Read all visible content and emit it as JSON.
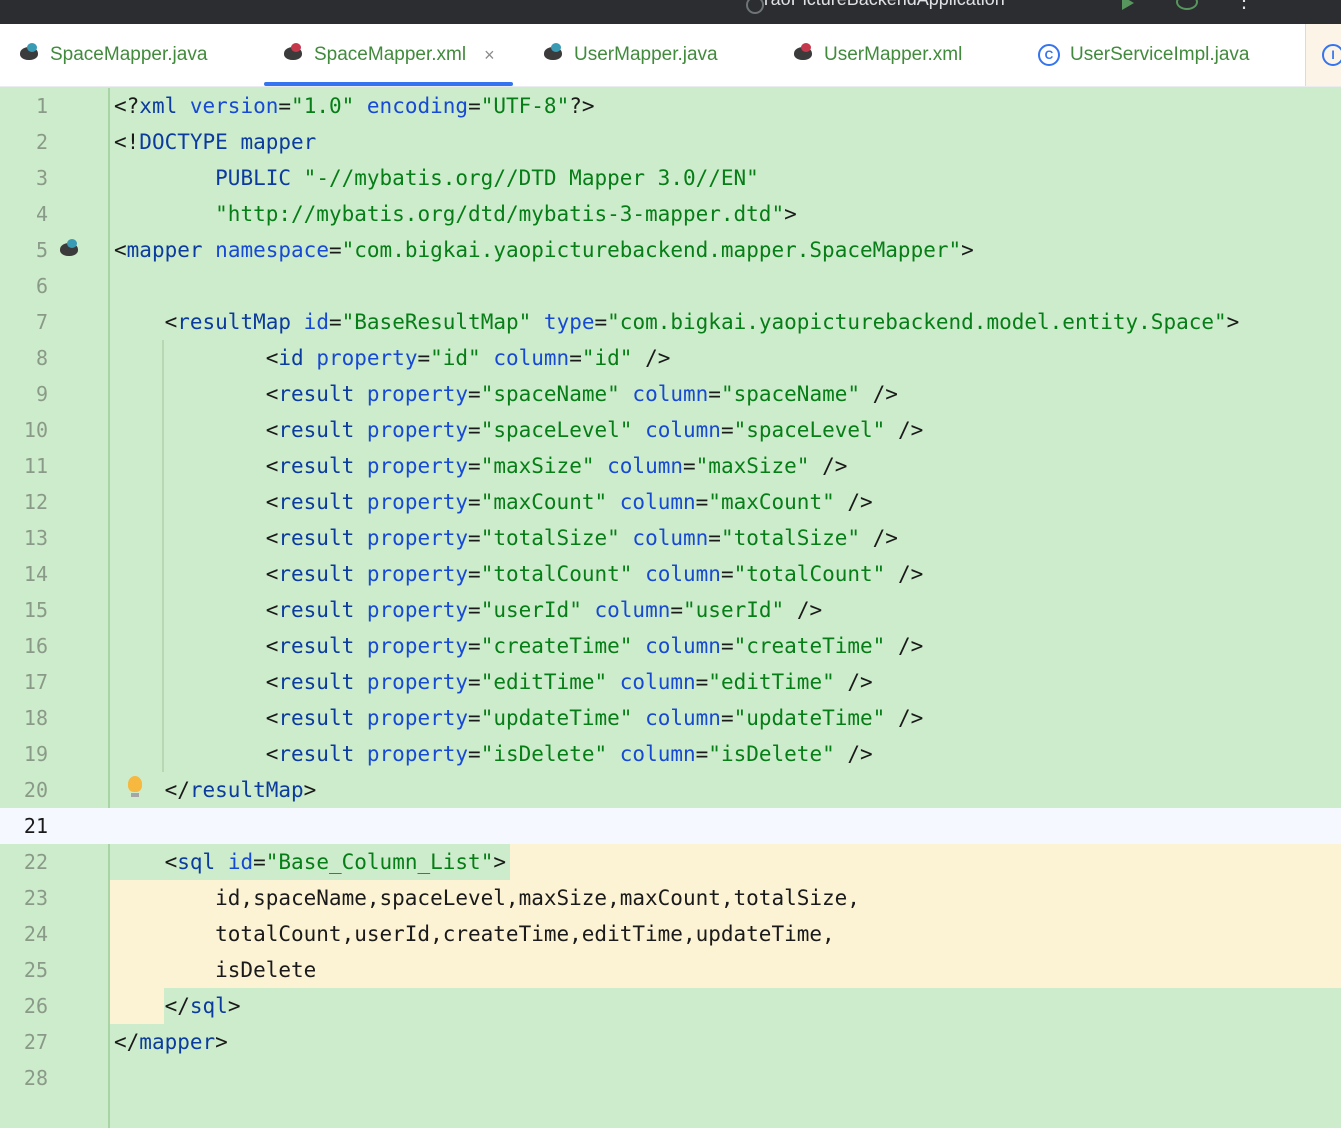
{
  "topbar": {
    "run_config": "YaoPictureBackendApplication"
  },
  "tabs": [
    {
      "label": "SpaceMapper.java",
      "icon": "mybatis-java-icon"
    },
    {
      "label": "SpaceMapper.xml",
      "icon": "mybatis-xml-icon",
      "active": true,
      "close": "×"
    },
    {
      "label": "UserMapper.java",
      "icon": "mybatis-java-icon"
    },
    {
      "label": "UserMapper.xml",
      "icon": "mybatis-xml-icon"
    },
    {
      "label": "UserServiceImpl.java",
      "icon": "class-icon"
    }
  ],
  "class_icon_glyph": "C",
  "colors": {
    "editor_bg": "#cdeccb",
    "tag": "#0b3b9e",
    "attribute": "#174ad4",
    "string": "#067d17",
    "active_tab_underline": "#3574f0",
    "sql_highlight": "#fcf2d4"
  },
  "line_numbers": [
    "1",
    "2",
    "3",
    "4",
    "5",
    "6",
    "7",
    "8",
    "9",
    "10",
    "11",
    "12",
    "13",
    "14",
    "15",
    "16",
    "17",
    "18",
    "19",
    "20",
    "21",
    "22",
    "23",
    "24",
    "25",
    "26",
    "27",
    "28"
  ],
  "code": {
    "l1": [
      [
        "t",
        "<?"
      ],
      [
        "tag",
        "xml "
      ],
      [
        "att",
        "version"
      ],
      [
        "pl",
        "="
      ],
      [
        "str",
        "\"1.0\" "
      ],
      [
        "att",
        "encoding"
      ],
      [
        "pl",
        "="
      ],
      [
        "str",
        "\"UTF-8\""
      ],
      [
        "t",
        "?>"
      ]
    ],
    "l2": [
      [
        "t",
        "<!"
      ],
      [
        "tag",
        "DOCTYPE "
      ],
      [
        "tag",
        "mapper"
      ]
    ],
    "l3": [
      [
        "pl",
        "        "
      ],
      [
        "tag",
        "PUBLIC "
      ],
      [
        "str",
        "\"-//mybatis.org//DTD Mapper 3.0//EN\""
      ]
    ],
    "l4": [
      [
        "pl",
        "        "
      ],
      [
        "str",
        "\"http://mybatis.org/dtd/mybatis-3-mapper.dtd\""
      ],
      [
        "t",
        ">"
      ]
    ],
    "l5": [
      [
        "t",
        "<"
      ],
      [
        "tag",
        "mapper "
      ],
      [
        "att",
        "namespace"
      ],
      [
        "pl",
        "="
      ],
      [
        "str",
        "\"com.bigkai.yaopicturebackend.mapper.SpaceMapper\""
      ],
      [
        "t",
        ">"
      ]
    ],
    "l6": [],
    "l7": [
      [
        "pl",
        "    "
      ],
      [
        "t",
        "<"
      ],
      [
        "tag",
        "resultMap "
      ],
      [
        "att",
        "id"
      ],
      [
        "pl",
        "="
      ],
      [
        "str",
        "\"BaseResultMap\" "
      ],
      [
        "att",
        "type"
      ],
      [
        "pl",
        "="
      ],
      [
        "str",
        "\"com.bigkai.yaopicturebackend.model.entity.Space\""
      ],
      [
        "t",
        ">"
      ]
    ],
    "l8": [
      [
        "pl",
        "            "
      ],
      [
        "t",
        "<"
      ],
      [
        "tag",
        "id "
      ],
      [
        "att",
        "property"
      ],
      [
        "pl",
        "="
      ],
      [
        "str",
        "\"id\" "
      ],
      [
        "att",
        "column"
      ],
      [
        "pl",
        "="
      ],
      [
        "str",
        "\"id\" "
      ],
      [
        "t",
        "/>"
      ]
    ],
    "l9": [
      [
        "pl",
        "            "
      ],
      [
        "t",
        "<"
      ],
      [
        "tag",
        "result "
      ],
      [
        "att",
        "property"
      ],
      [
        "pl",
        "="
      ],
      [
        "str",
        "\"spaceName\" "
      ],
      [
        "att",
        "column"
      ],
      [
        "pl",
        "="
      ],
      [
        "str",
        "\"spaceName\" "
      ],
      [
        "t",
        "/>"
      ]
    ],
    "l10": [
      [
        "pl",
        "            "
      ],
      [
        "t",
        "<"
      ],
      [
        "tag",
        "result "
      ],
      [
        "att",
        "property"
      ],
      [
        "pl",
        "="
      ],
      [
        "str",
        "\"spaceLevel\" "
      ],
      [
        "att",
        "column"
      ],
      [
        "pl",
        "="
      ],
      [
        "str",
        "\"spaceLevel\" "
      ],
      [
        "t",
        "/>"
      ]
    ],
    "l11": [
      [
        "pl",
        "            "
      ],
      [
        "t",
        "<"
      ],
      [
        "tag",
        "result "
      ],
      [
        "att",
        "property"
      ],
      [
        "pl",
        "="
      ],
      [
        "str",
        "\"maxSize\" "
      ],
      [
        "att",
        "column"
      ],
      [
        "pl",
        "="
      ],
      [
        "str",
        "\"maxSize\" "
      ],
      [
        "t",
        "/>"
      ]
    ],
    "l12": [
      [
        "pl",
        "            "
      ],
      [
        "t",
        "<"
      ],
      [
        "tag",
        "result "
      ],
      [
        "att",
        "property"
      ],
      [
        "pl",
        "="
      ],
      [
        "str",
        "\"maxCount\" "
      ],
      [
        "att",
        "column"
      ],
      [
        "pl",
        "="
      ],
      [
        "str",
        "\"maxCount\" "
      ],
      [
        "t",
        "/>"
      ]
    ],
    "l13": [
      [
        "pl",
        "            "
      ],
      [
        "t",
        "<"
      ],
      [
        "tag",
        "result "
      ],
      [
        "att",
        "property"
      ],
      [
        "pl",
        "="
      ],
      [
        "str",
        "\"totalSize\" "
      ],
      [
        "att",
        "column"
      ],
      [
        "pl",
        "="
      ],
      [
        "str",
        "\"totalSize\" "
      ],
      [
        "t",
        "/>"
      ]
    ],
    "l14": [
      [
        "pl",
        "            "
      ],
      [
        "t",
        "<"
      ],
      [
        "tag",
        "result "
      ],
      [
        "att",
        "property"
      ],
      [
        "pl",
        "="
      ],
      [
        "str",
        "\"totalCount\" "
      ],
      [
        "att",
        "column"
      ],
      [
        "pl",
        "="
      ],
      [
        "str",
        "\"totalCount\" "
      ],
      [
        "t",
        "/>"
      ]
    ],
    "l15": [
      [
        "pl",
        "            "
      ],
      [
        "t",
        "<"
      ],
      [
        "tag",
        "result "
      ],
      [
        "att",
        "property"
      ],
      [
        "pl",
        "="
      ],
      [
        "str",
        "\"userId\" "
      ],
      [
        "att",
        "column"
      ],
      [
        "pl",
        "="
      ],
      [
        "str",
        "\"userId\" "
      ],
      [
        "t",
        "/>"
      ]
    ],
    "l16": [
      [
        "pl",
        "            "
      ],
      [
        "t",
        "<"
      ],
      [
        "tag",
        "result "
      ],
      [
        "att",
        "property"
      ],
      [
        "pl",
        "="
      ],
      [
        "str",
        "\"createTime\" "
      ],
      [
        "att",
        "column"
      ],
      [
        "pl",
        "="
      ],
      [
        "str",
        "\"createTime\" "
      ],
      [
        "t",
        "/>"
      ]
    ],
    "l17": [
      [
        "pl",
        "            "
      ],
      [
        "t",
        "<"
      ],
      [
        "tag",
        "result "
      ],
      [
        "att",
        "property"
      ],
      [
        "pl",
        "="
      ],
      [
        "str",
        "\"editTime\" "
      ],
      [
        "att",
        "column"
      ],
      [
        "pl",
        "="
      ],
      [
        "str",
        "\"editTime\" "
      ],
      [
        "t",
        "/>"
      ]
    ],
    "l18": [
      [
        "pl",
        "            "
      ],
      [
        "t",
        "<"
      ],
      [
        "tag",
        "result "
      ],
      [
        "att",
        "property"
      ],
      [
        "pl",
        "="
      ],
      [
        "str",
        "\"updateTime\" "
      ],
      [
        "att",
        "column"
      ],
      [
        "pl",
        "="
      ],
      [
        "str",
        "\"updateTime\" "
      ],
      [
        "t",
        "/>"
      ]
    ],
    "l19": [
      [
        "pl",
        "            "
      ],
      [
        "t",
        "<"
      ],
      [
        "tag",
        "result "
      ],
      [
        "att",
        "property"
      ],
      [
        "pl",
        "="
      ],
      [
        "str",
        "\"isDelete\" "
      ],
      [
        "att",
        "column"
      ],
      [
        "pl",
        "="
      ],
      [
        "str",
        "\"isDelete\" "
      ],
      [
        "t",
        "/>"
      ]
    ],
    "l20": [
      [
        "pl",
        "    "
      ],
      [
        "t",
        "</"
      ],
      [
        "tag",
        "resultMap"
      ],
      [
        "t",
        ">"
      ]
    ],
    "l21": [],
    "l22": [
      [
        "pl",
        "    "
      ],
      [
        "t",
        "<"
      ],
      [
        "tag",
        "sql "
      ],
      [
        "att",
        "id"
      ],
      [
        "pl",
        "="
      ],
      [
        "str",
        "\"Base_Column_List\""
      ],
      [
        "t",
        ">"
      ]
    ],
    "l23": [
      [
        "pl",
        "        id,spaceName,spaceLevel,maxSize,maxCount,totalSize,"
      ]
    ],
    "l24": [
      [
        "pl",
        "        totalCount,userId,createTime,editTime,updateTime,"
      ]
    ],
    "l25": [
      [
        "pl",
        "        isDelete"
      ]
    ],
    "l26": [
      [
        "pl",
        "    "
      ],
      [
        "t",
        "</"
      ],
      [
        "tag",
        "sql"
      ],
      [
        "t",
        ">"
      ]
    ],
    "l27": [
      [
        "t",
        "</"
      ],
      [
        "tag",
        "mapper"
      ],
      [
        "t",
        ">"
      ]
    ],
    "l28": []
  }
}
